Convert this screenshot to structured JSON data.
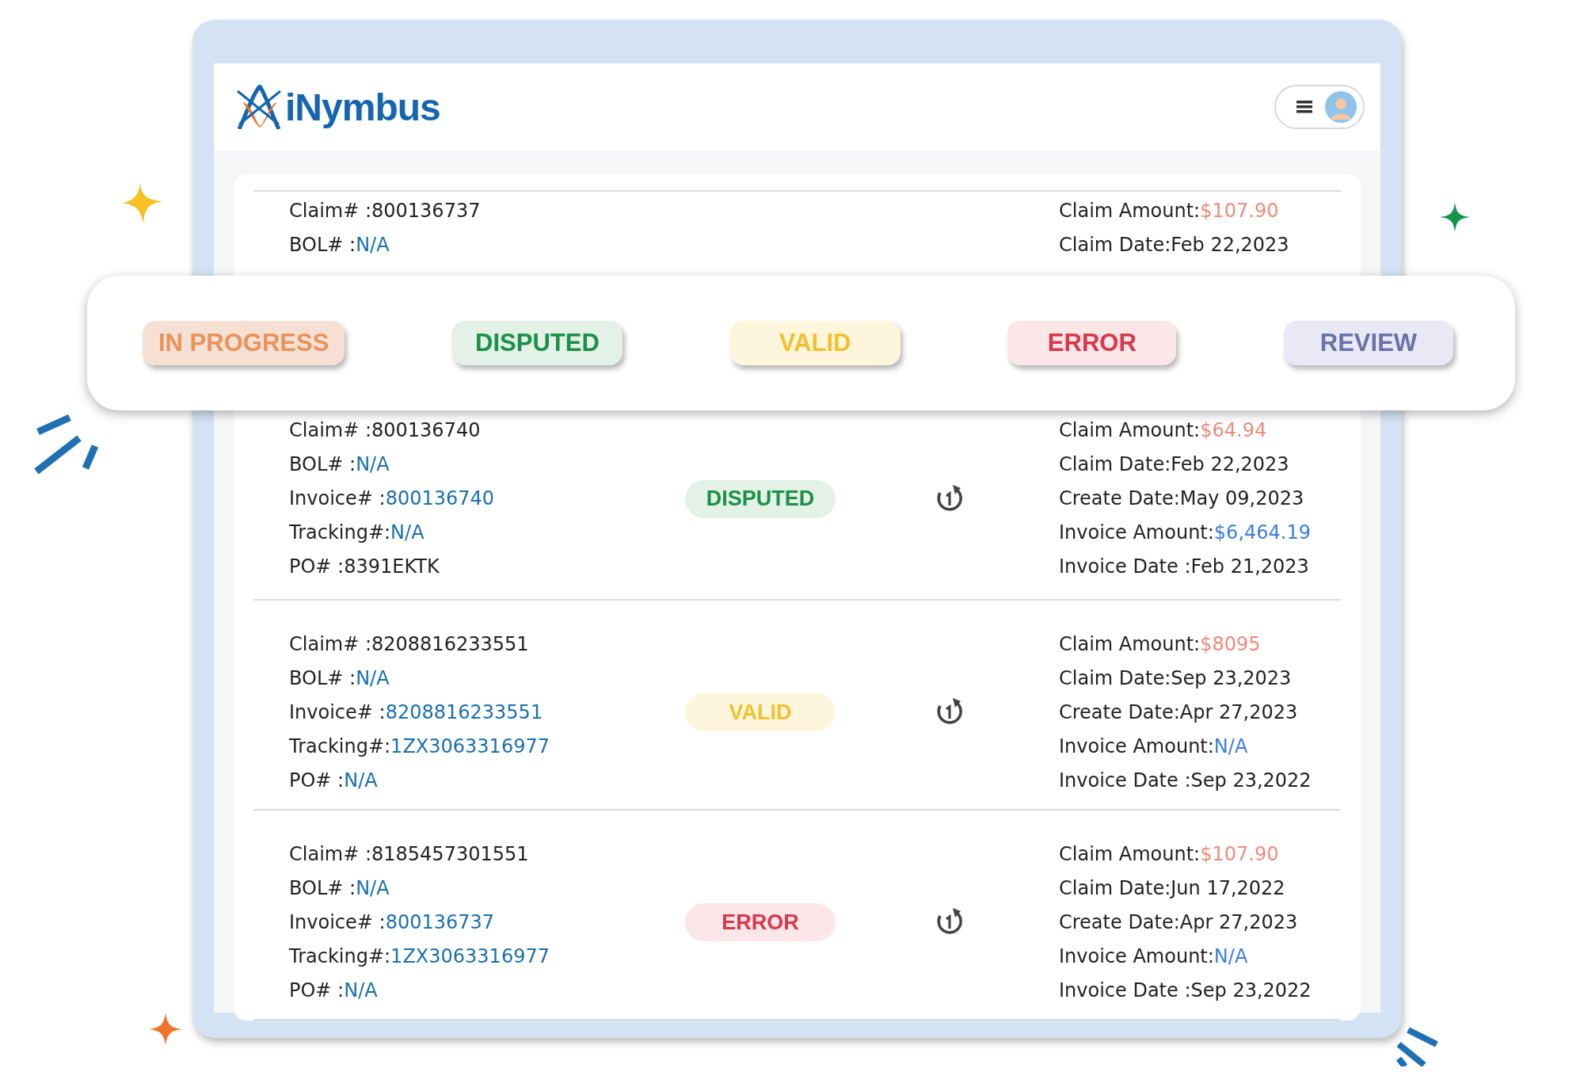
{
  "header": {
    "logo_text": "iNymbus"
  },
  "claims": [
    {
      "left": [
        {
          "label": "Claim# :",
          "value": "800136737",
          "kind": "plain"
        },
        {
          "label": "BOL# :",
          "value": "N/A",
          "kind": "link"
        }
      ],
      "right": [
        {
          "label": "Claim Amount:",
          "value": "$107.90",
          "kind": "amount"
        },
        {
          "label": "Claim Date:",
          "value": "Feb 22,2023",
          "kind": "plain"
        }
      ]
    },
    {
      "left": [
        {
          "label": "Claim# :",
          "value": "800136740",
          "kind": "plain"
        },
        {
          "label": "BOL# :",
          "value": "N/A",
          "kind": "link"
        },
        {
          "label": "Invoice# :",
          "value": "800136740",
          "kind": "link"
        },
        {
          "label": "Tracking#:",
          "value": "N/A",
          "kind": "link"
        },
        {
          "label": "PO# :",
          "value": "8391EKTK",
          "kind": "plain"
        }
      ],
      "badge": {
        "kind": "disputed",
        "label": "DISPUTED"
      },
      "right": [
        {
          "label": "Claim Amount:",
          "value": "$64.94",
          "kind": "amount"
        },
        {
          "label": "Claim Date:",
          "value": "Feb 22,2023",
          "kind": "plain"
        },
        {
          "label": "Create Date:",
          "value": "May 09,2023",
          "kind": "plain"
        },
        {
          "label": "Invoice Amount:",
          "value": "$6,464.19",
          "kind": "money"
        },
        {
          "label": "Invoice Date :",
          "value": "Feb 21,2023",
          "kind": "plain"
        }
      ]
    },
    {
      "left": [
        {
          "label": "Claim# :",
          "value": "8208816233551",
          "kind": "plain"
        },
        {
          "label": "BOL# :",
          "value": "N/A",
          "kind": "link"
        },
        {
          "label": "Invoice# :",
          "value": "8208816233551",
          "kind": "link"
        },
        {
          "label": "Tracking#:",
          "value": "1ZX3063316977",
          "kind": "link"
        },
        {
          "label": "PO# :",
          "value": "N/A",
          "kind": "link"
        }
      ],
      "badge": {
        "kind": "valid",
        "label": "VALID"
      },
      "right": [
        {
          "label": "Claim Amount:",
          "value": "$8095",
          "kind": "amount"
        },
        {
          "label": "Claim Date:",
          "value": "Sep 23,2023",
          "kind": "plain"
        },
        {
          "label": "Create Date:",
          "value": "Apr 27,2023",
          "kind": "plain"
        },
        {
          "label": "Invoice Amount:",
          "value": "N/A",
          "kind": "money"
        },
        {
          "label": "Invoice Date :",
          "value": "Sep 23,2022",
          "kind": "plain"
        }
      ]
    },
    {
      "left": [
        {
          "label": "Claim# :",
          "value": "8185457301551",
          "kind": "plain"
        },
        {
          "label": "BOL# :",
          "value": "N/A",
          "kind": "link"
        },
        {
          "label": "Invoice# :",
          "value": "800136737",
          "kind": "link"
        },
        {
          "label": "Tracking#:",
          "value": "1ZX3063316977",
          "kind": "link"
        },
        {
          "label": "PO# :",
          "value": "N/A",
          "kind": "link"
        }
      ],
      "badge": {
        "kind": "error",
        "label": "ERROR"
      },
      "right": [
        {
          "label": "Claim Amount:",
          "value": "$107.90",
          "kind": "amount"
        },
        {
          "label": "Claim Date:",
          "value": "Jun 17,2022",
          "kind": "plain"
        },
        {
          "label": "Create Date:",
          "value": "Apr 27,2023",
          "kind": "plain"
        },
        {
          "label": "Invoice Amount:",
          "value": "N/A",
          "kind": "money"
        },
        {
          "label": "Invoice Date :",
          "value": "Sep 23,2022",
          "kind": "plain"
        }
      ]
    }
  ],
  "legend": [
    {
      "kind": "in_progress",
      "label": "IN PROGRESS"
    },
    {
      "kind": "disputed",
      "label": "DISPUTED"
    },
    {
      "kind": "valid",
      "label": "VALID"
    },
    {
      "kind": "error",
      "label": "ERROR"
    },
    {
      "kind": "review",
      "label": "REVIEW"
    }
  ]
}
